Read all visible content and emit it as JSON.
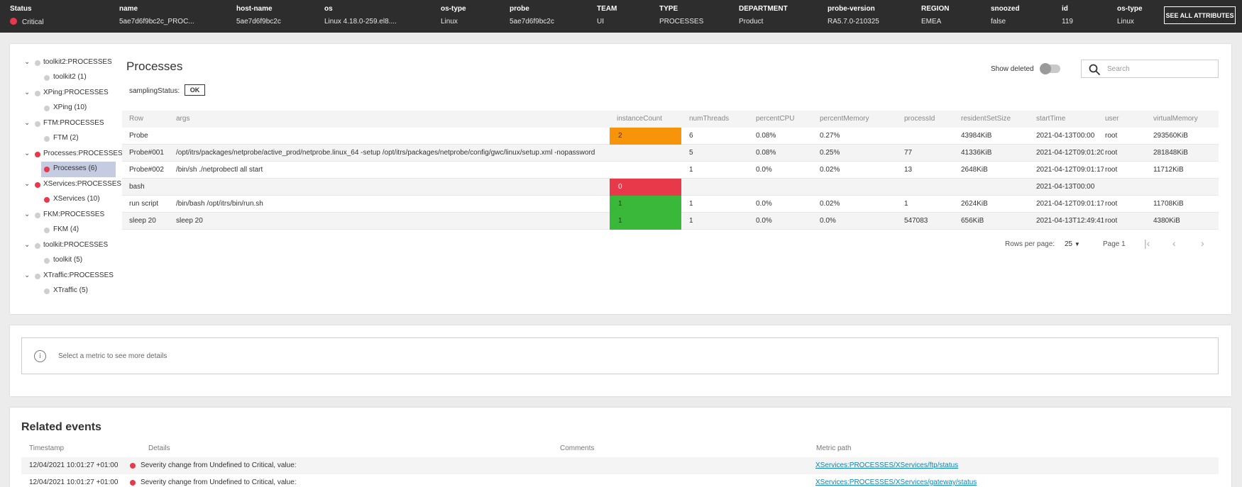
{
  "header_attrs": [
    {
      "key": "Status",
      "value": "Critical"
    },
    {
      "key": "name",
      "value": "5ae7d6f9bc2c_PROC..."
    },
    {
      "key": "host-name",
      "value": "5ae7d6f9bc2c"
    },
    {
      "key": "os",
      "value": "Linux 4.18.0-259.el8...."
    },
    {
      "key": "os-type",
      "value": "Linux"
    },
    {
      "key": "probe",
      "value": "5ae7d6f9bc2c"
    },
    {
      "key": "TEAM",
      "value": "UI"
    },
    {
      "key": "TYPE",
      "value": "PROCESSES"
    },
    {
      "key": "DEPARTMENT",
      "value": "Product"
    },
    {
      "key": "probe-version",
      "value": "RA5.7.0-210325"
    },
    {
      "key": "REGION",
      "value": "EMEA"
    },
    {
      "key": "snoozed",
      "value": "false"
    },
    {
      "key": "id",
      "value": "119"
    },
    {
      "key": "os-type",
      "value": "Linux"
    }
  ],
  "see_all_label": "SEE ALL ATTRIBUTES",
  "colors": {
    "critical": "#e8394a",
    "warning": "#f7940a",
    "ok": "#3ab83a",
    "undefined": "#cfcfcf",
    "selected": "#c5cbe0",
    "topbar": "#2d2d2d"
  },
  "tree": [
    {
      "label": "toolkit2:PROCESSES",
      "status": "undefined",
      "child": "toolkit2 (1)",
      "selected": false
    },
    {
      "label": "XPing:PROCESSES",
      "status": "undefined",
      "child": "XPing (10)",
      "selected": false
    },
    {
      "label": "FTM:PROCESSES",
      "status": "undefined",
      "child": "FTM (2)",
      "selected": false
    },
    {
      "label": "Processes:PROCESSES",
      "status": "critical",
      "child": "Processes (6)",
      "selected": true
    },
    {
      "label": "XServices:PROCESSES",
      "status": "critical",
      "child": "XServices (10)",
      "selected": false
    },
    {
      "label": "FKM:PROCESSES",
      "status": "undefined",
      "child": "FKM (4)",
      "selected": false
    },
    {
      "label": "toolkit:PROCESSES",
      "status": "undefined",
      "child": "toolkit (5)",
      "selected": false
    },
    {
      "label": "XTraffic:PROCESSES",
      "status": "undefined",
      "child": "XTraffic (5)",
      "selected": false
    }
  ],
  "processes": {
    "title": "Processes",
    "sampling_label": "samplingStatus:",
    "sampling_value": "OK",
    "show_deleted_label": "Show deleted",
    "show_deleted": false,
    "search_placeholder": "Search",
    "columns": [
      "Row",
      "args",
      "instanceCount",
      "numThreads",
      "percentCPU",
      "percentMemory",
      "processId",
      "residentSetSize",
      "startTime",
      "user",
      "virtualMemory"
    ],
    "rows": [
      {
        "cells": [
          "Probe",
          "",
          "2",
          "6",
          "0.08%",
          "0.27%",
          "",
          "43984KiB",
          "2021-04-13T00:00",
          "root",
          "293560KiB"
        ],
        "ic_status": "warning"
      },
      {
        "cells": [
          "Probe#001",
          "/opt/itrs/packages/netprobe/active_prod/netprobe.linux_64 -setup /opt/itrs/packages/netprobe/config/gwc/linux/setup.xml -nopassword",
          "",
          "5",
          "0.08%",
          "0.25%",
          "77",
          "41336KiB",
          "2021-04-12T09:01:20",
          "root",
          "281848KiB"
        ],
        "ic_status": ""
      },
      {
        "cells": [
          "Probe#002",
          "/bin/sh ./netprobectl all start",
          "",
          "1",
          "0.0%",
          "0.02%",
          "13",
          "2648KiB",
          "2021-04-12T09:01:17",
          "root",
          "11712KiB"
        ],
        "ic_status": ""
      },
      {
        "cells": [
          "bash",
          "",
          "0",
          "",
          "",
          "",
          "",
          "",
          "2021-04-13T00:00",
          "",
          ""
        ],
        "ic_status": "critical"
      },
      {
        "cells": [
          "run script",
          "/bin/bash /opt/itrs/bin/run.sh",
          "1",
          "1",
          "0.0%",
          "0.02%",
          "1",
          "2624KiB",
          "2021-04-12T09:01:17",
          "root",
          "11708KiB"
        ],
        "ic_status": "ok"
      },
      {
        "cells": [
          "sleep 20",
          "sleep 20",
          "1",
          "1",
          "0.0%",
          "0.0%",
          "547083",
          "656KiB",
          "2021-04-13T12:49:41",
          "root",
          "4380KiB"
        ],
        "ic_status": "ok"
      }
    ],
    "pagination": {
      "rows_per_page_label": "Rows per page:",
      "rows_per_page": "25",
      "page_label": "Page 1"
    }
  },
  "details": {
    "message": "Select a metric to see more details",
    "info_glyph": "i"
  },
  "related_events": {
    "title": "Related events",
    "columns": [
      "Timestamp",
      "Details",
      "Comments",
      "Metric path"
    ],
    "rows": [
      {
        "timestamp": "12/04/2021 10:01:27 +01:00",
        "details": "Severity change from Undefined to Critical, value:",
        "comments": "",
        "metric_path": "XServices:PROCESSES/XServices/ftp/status"
      },
      {
        "timestamp": "12/04/2021 10:01:27 +01:00",
        "details": "Severity change from Undefined to Critical, value:",
        "comments": "",
        "metric_path": "XServices:PROCESSES/XServices/gateway/status"
      }
    ]
  }
}
